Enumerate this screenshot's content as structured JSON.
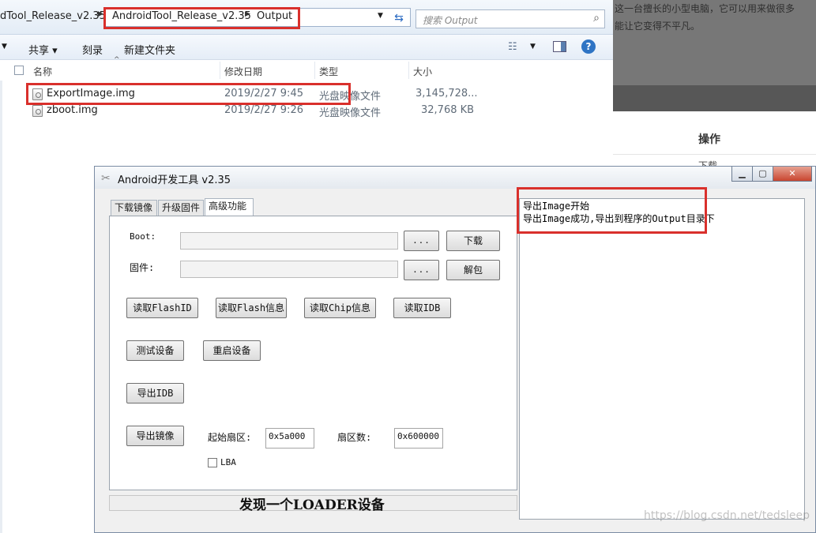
{
  "explorer": {
    "breadcrumb": [
      "dTool_Release_v2.35",
      "AndroidTool_Release_v2.35",
      "Output"
    ],
    "search_placeholder": "搜索 Output",
    "toolbar": {
      "share": "共享 ▾",
      "burn": "刻录",
      "new_folder": "新建文件夹"
    },
    "columns": {
      "name": "名称",
      "date": "修改日期",
      "type": "类型",
      "size": "大小"
    },
    "files": [
      {
        "name": "ExportImage.img",
        "date": "2019/2/27 9:45",
        "type": "光盘映像文件",
        "size": "3,145,728..."
      },
      {
        "name": "zboot.img",
        "date": "2019/2/27 9:26",
        "type": "光盘映像文件",
        "size": "32,768 KB"
      }
    ]
  },
  "background": {
    "text_line1": "这一台擅长的小型电脑，它可以用来做很多",
    "text_line2": "能让它变得不平凡。",
    "operation_heading": "操作",
    "download_link": "下载"
  },
  "tool": {
    "title": "Android开发工具 v2.35",
    "tabs": [
      "下载镜像",
      "升级固件",
      "高级功能"
    ],
    "boot_label": "Boot:",
    "firmware_label": "固件:",
    "browse_label": "...",
    "download_button": "下载",
    "unpack_button": "解包",
    "read_flash_id": "读取FlashID",
    "read_flash_info": "读取Flash信息",
    "read_chip_info": "读取Chip信息",
    "read_idb": "读取IDB",
    "test_device": "测试设备",
    "reboot_device": "重启设备",
    "export_idb": "导出IDB",
    "export_image": "导出镜像",
    "start_sector_label": "起始扇区:",
    "start_sector_value": "0x5a000",
    "sector_count_label": "扇区数:",
    "sector_count_value": "0x600000",
    "lba_label": "LBA",
    "status": "发现一个LOADER设备",
    "log": [
      "导出Image开始",
      "导出Image成功,导出到程序的Output目录下"
    ]
  },
  "watermark": "https://blog.csdn.net/tedsleep"
}
